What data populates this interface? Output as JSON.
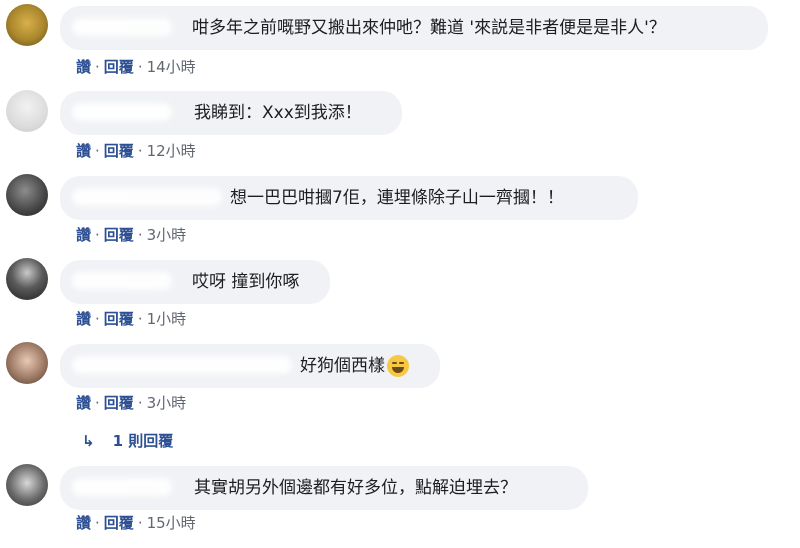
{
  "comments": [
    {
      "text": "咁多年之前嘅野又搬出來仲吔？難道 '來説是非者便是是非人'？",
      "like": "讚",
      "reply": "回覆",
      "time": "14小時"
    },
    {
      "text": "我睇到：Xxx到我添！",
      "like": "讚",
      "reply": "回覆",
      "time": "12小時"
    },
    {
      "text": "想一巴巴咁摑7佢，連埋條除子山一齊摑！！",
      "like": "讚",
      "reply": "回覆",
      "time": "3小時"
    },
    {
      "text": "哎呀 撞到你啄",
      "like": "讚",
      "reply": "回覆",
      "time": "1小時"
    },
    {
      "text": "好狗個西樣",
      "emoji": "grinning-sweat-emoji",
      "like": "讚",
      "reply": "回覆",
      "time": "3小時"
    },
    {
      "text": "其實胡另外個邊都有好多位，點解迫埋去？",
      "like": "讚",
      "reply": "回覆",
      "time": "15小時"
    }
  ],
  "replies_link": {
    "icon": "reply-arrow-icon",
    "arrow": "↳",
    "label": "1 則回覆"
  },
  "colors": {
    "bubble": "#f0f2f5",
    "link": "#2d4f93",
    "meta": "#606770",
    "text": "#1c1e21"
  }
}
